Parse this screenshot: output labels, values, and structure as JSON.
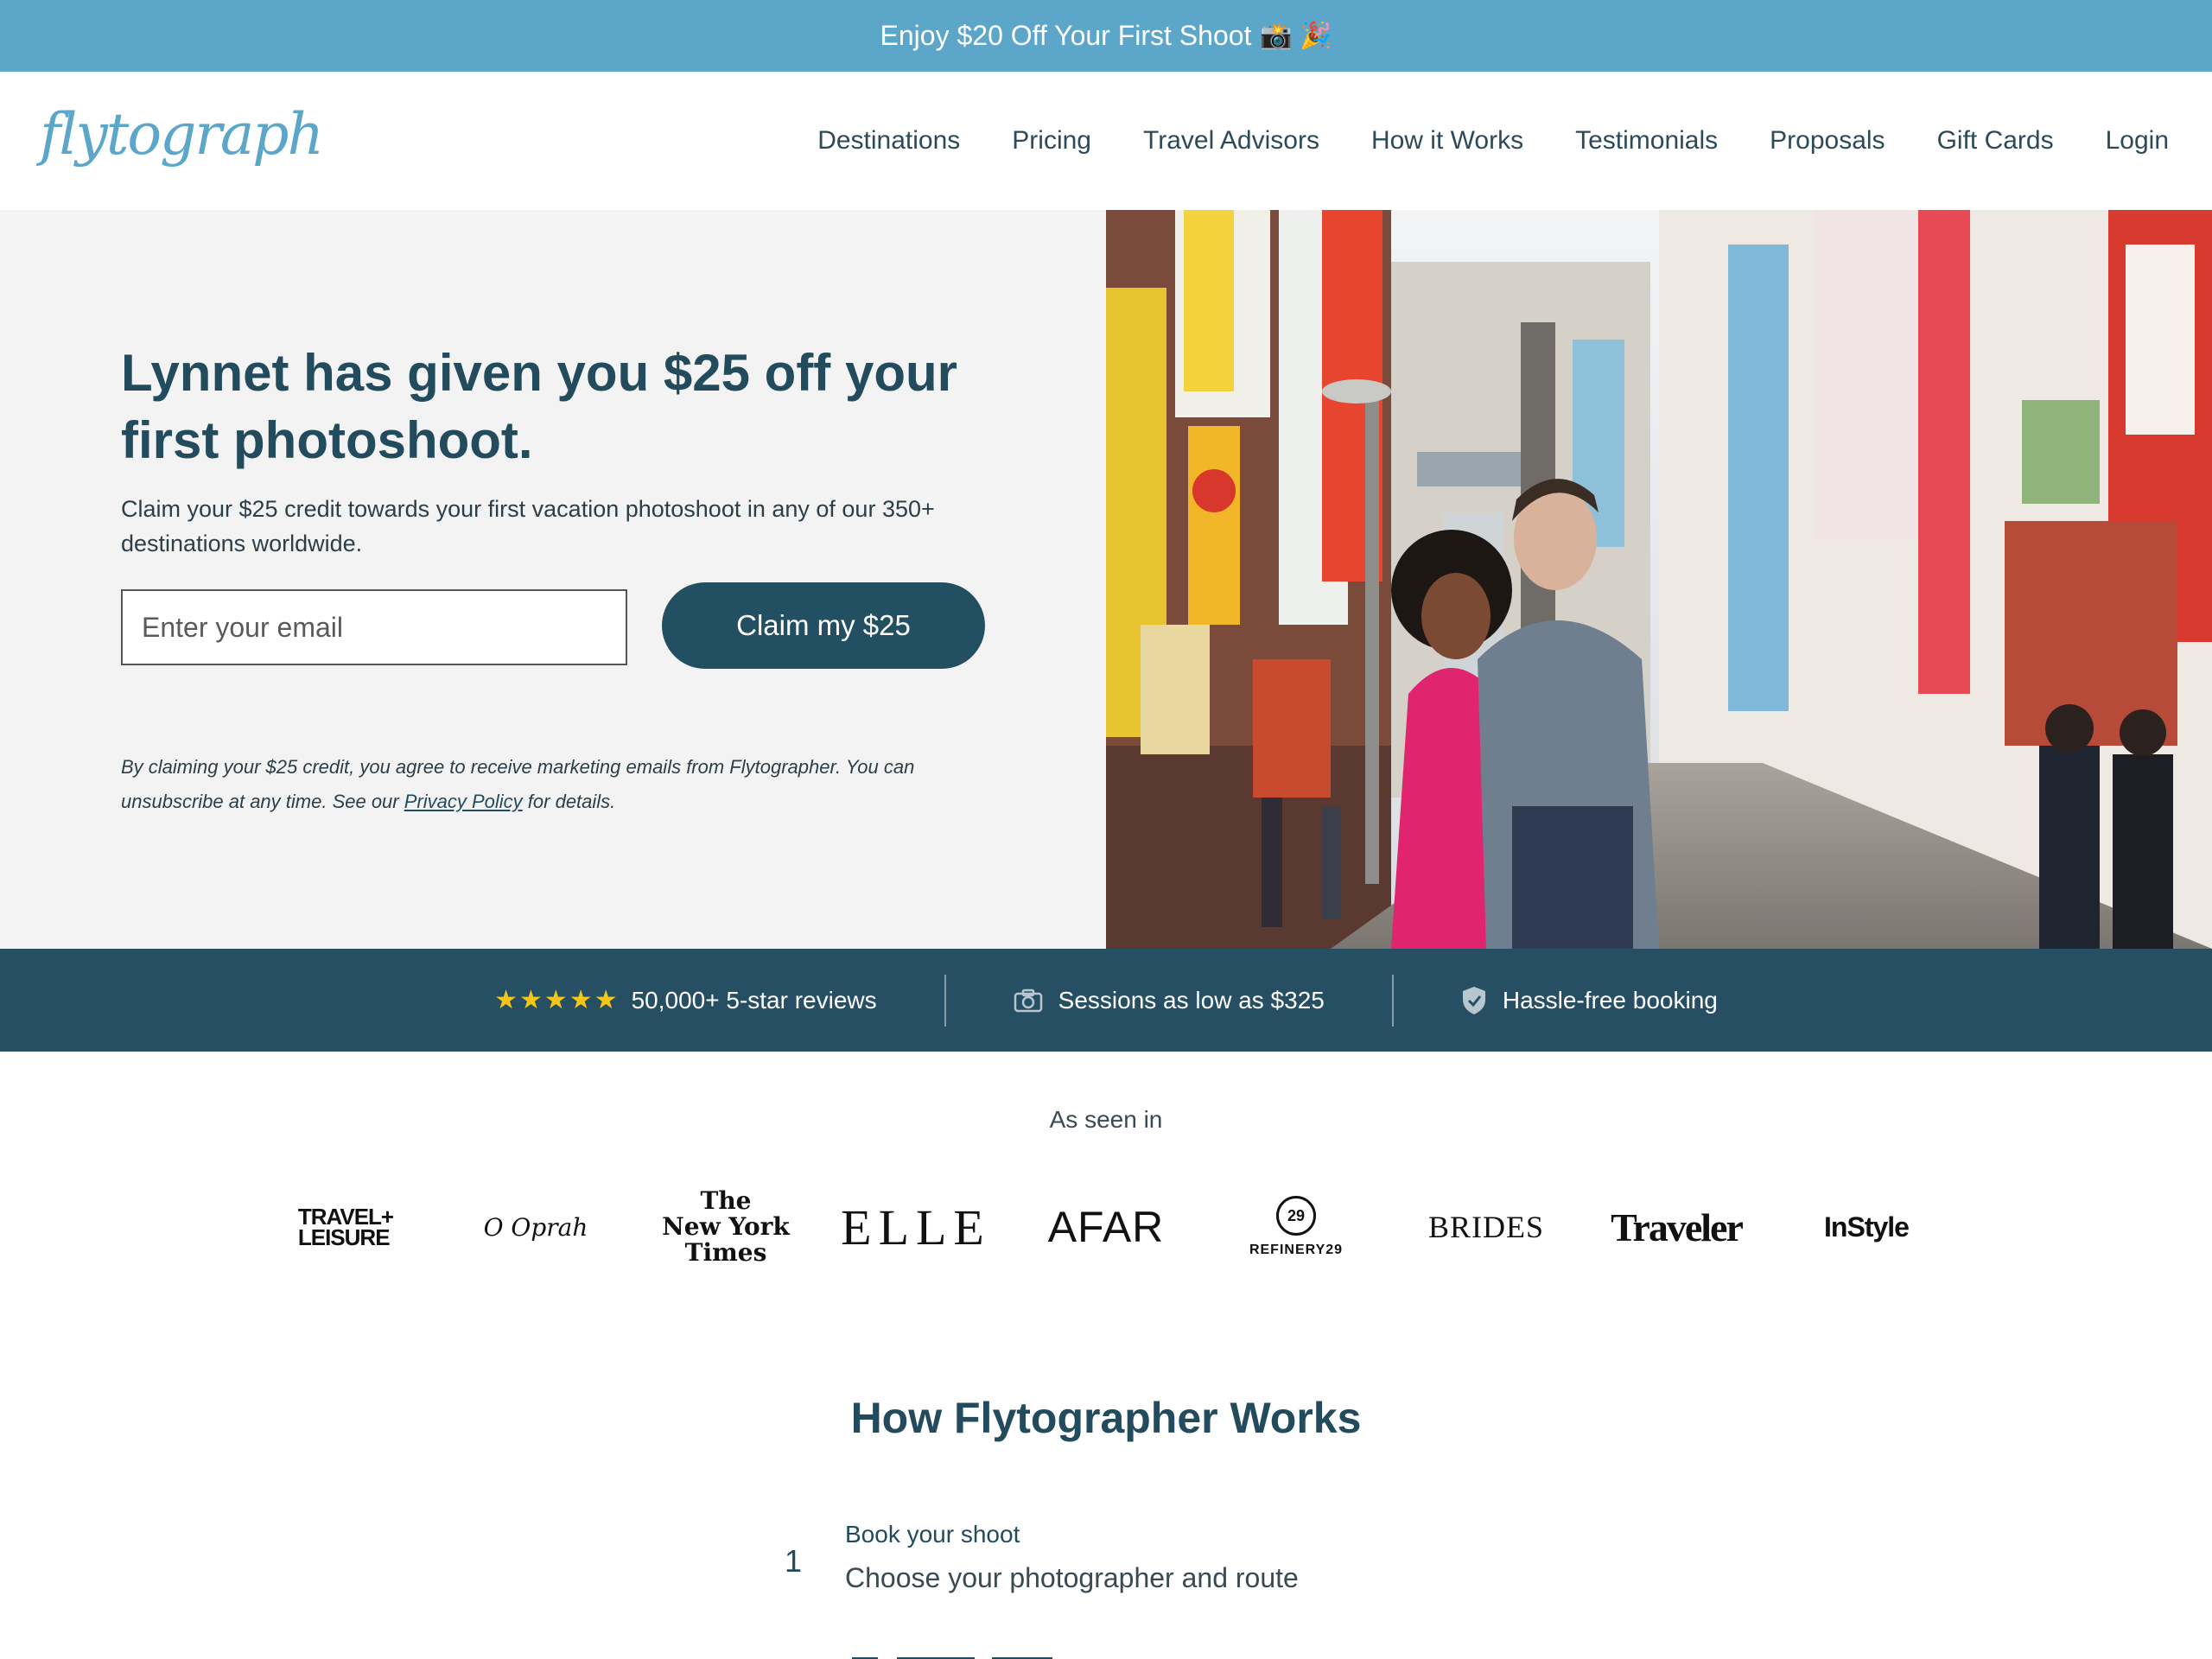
{
  "promo": {
    "text": "Enjoy $20 Off Your First Shoot",
    "emoji": "📸 🎉"
  },
  "header": {
    "logo_text": "flytographer",
    "nav": [
      "Destinations",
      "Pricing",
      "Travel Advisors",
      "How it Works",
      "Testimonials",
      "Proposals",
      "Gift Cards",
      "Login"
    ]
  },
  "hero": {
    "title": "Lynnet has given you $25 off your first photoshoot.",
    "subtitle": "Claim your $25 credit towards your first vacation photoshoot in any of our 350+ destinations worldwide.",
    "email_placeholder": "Enter your email",
    "cta_label": "Claim my $25",
    "disclaimer_before": "By claiming your $25 credit, you agree to receive marketing emails from Flytographer. You can unsubscribe at any time. See our",
    "privacy_link": "Privacy Policy",
    "disclaimer_after": "for details."
  },
  "trust": {
    "reviews": "50,000+ 5-star reviews",
    "sessions": "Sessions as low as $325",
    "booking": "Hassle-free booking"
  },
  "as_seen_in": {
    "heading": "As seen in",
    "logos": {
      "travel_leisure_1": "TRAVEL+",
      "travel_leisure_2": "LEISURE",
      "oprah": "O Oprah",
      "nyt_1": "The",
      "nyt_2": "New York",
      "nyt_3": "Times",
      "elle": "ELLE",
      "afar": "AFAR",
      "refinery_mark": "29",
      "refinery_label": "REFINERY29",
      "brides": "BRIDES",
      "traveler": "Traveler",
      "instyle": "InStyle"
    }
  },
  "how_it_works": {
    "title": "How Flytographer Works",
    "steps": [
      {
        "number": "1",
        "title": "Book your shoot",
        "description": "Choose your photographer and route"
      }
    ]
  },
  "colors": {
    "banner": "#5ba6c9",
    "primary": "#234f63",
    "star": "#f5c518",
    "hero_bg": "#f3f3f3"
  }
}
